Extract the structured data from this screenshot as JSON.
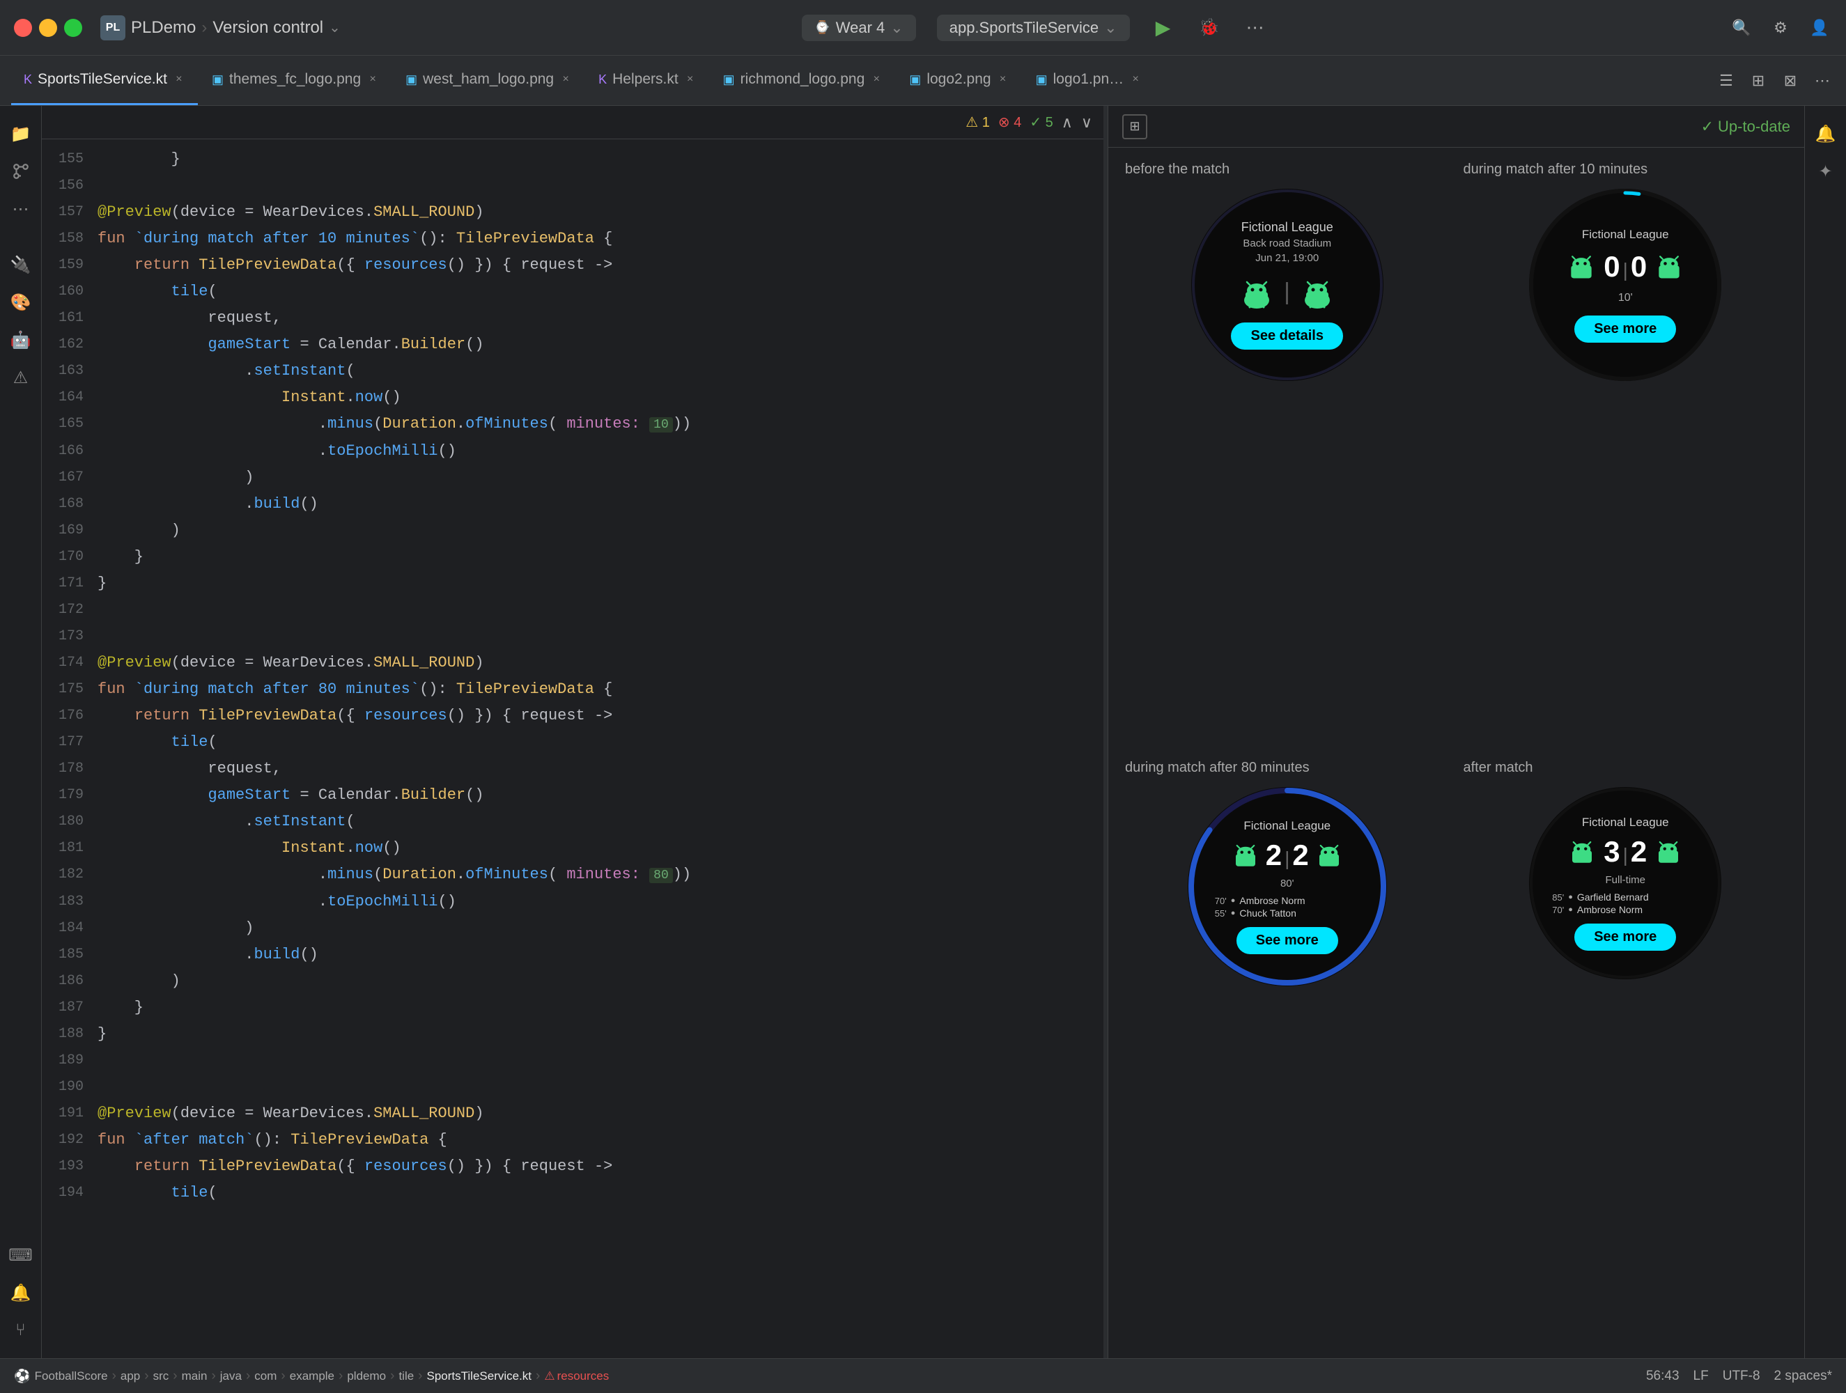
{
  "titlebar": {
    "traffic_lights": [
      "red",
      "yellow",
      "green"
    ],
    "brand_label": "PL",
    "app_name": "PLDemo",
    "vcs_label": "Version control",
    "device_label": "Wear 4",
    "service_label": "app.SportsTileService",
    "run_label": "▶",
    "debug_label": "🐞",
    "more_label": "⋯"
  },
  "tabs": [
    {
      "label": "SportsTileService.kt",
      "active": true,
      "icon": "kotlin"
    },
    {
      "label": "themes_fc_logo.png",
      "active": false,
      "icon": "image"
    },
    {
      "label": "west_ham_logo.png",
      "active": false,
      "icon": "image"
    },
    {
      "label": "Helpers.kt",
      "active": false,
      "icon": "kotlin"
    },
    {
      "label": "richmond_logo.png",
      "active": false,
      "icon": "image"
    },
    {
      "label": "logo2.png",
      "active": false,
      "icon": "image"
    },
    {
      "label": "logo1.pn…",
      "active": false,
      "icon": "image"
    }
  ],
  "editor": {
    "warnings": 1,
    "errors": 4,
    "hints": 5,
    "lines": [
      {
        "num": 155,
        "tokens": [
          {
            "t": "indent",
            "v": "\t\t}"
          },
          {
            "t": "ident",
            "v": ""
          }
        ]
      },
      {
        "num": 156,
        "tokens": []
      },
      {
        "num": 157,
        "tokens": [
          {
            "t": "ann",
            "v": "@Preview"
          },
          {
            "t": "ident",
            "v": "(device = WearDevices."
          },
          {
            "t": "type",
            "v": "SMALL_ROUND"
          },
          {
            "t": "ident",
            "v": ")"
          }
        ]
      },
      {
        "num": 158,
        "tokens": [
          {
            "t": "kw",
            "v": "fun "
          },
          {
            "t": "fn",
            "v": "`during match after 10 minutes`"
          },
          {
            "t": "ident",
            "v": "(): "
          },
          {
            "t": "type",
            "v": "TilePreviewData"
          },
          {
            "t": "ident",
            "v": " {"
          }
        ]
      },
      {
        "num": 159,
        "tokens": [
          {
            "t": "ident",
            "v": "\t\t\t"
          },
          {
            "t": "kw",
            "v": "return "
          },
          {
            "t": "type",
            "v": "TilePreviewData"
          },
          {
            "t": "ident",
            "v": "({ "
          },
          {
            "t": "fn",
            "v": "resources"
          },
          {
            "t": "ident",
            "v": "() }) { request ->"
          }
        ]
      },
      {
        "num": 160,
        "tokens": [
          {
            "t": "ident",
            "v": "\t\t\t\t"
          },
          {
            "t": "fn",
            "v": "tile"
          },
          {
            "t": "ident",
            "v": "("
          }
        ]
      },
      {
        "num": 161,
        "tokens": [
          {
            "t": "ident",
            "v": "\t\t\t\t\trequest,"
          }
        ]
      },
      {
        "num": 162,
        "tokens": [
          {
            "t": "ident",
            "v": "\t\t\t\t\t"
          },
          {
            "t": "fn",
            "v": "gameStart"
          },
          {
            "t": "ident",
            "v": " = Calendar."
          },
          {
            "t": "type",
            "v": "Builder"
          },
          {
            "t": "ident",
            "v": "()"
          }
        ]
      },
      {
        "num": 163,
        "tokens": [
          {
            "t": "ident",
            "v": "\t\t\t\t\t\t."
          },
          {
            "t": "fn",
            "v": "setInstant"
          },
          {
            "t": "ident",
            "v": "("
          }
        ]
      },
      {
        "num": 164,
        "tokens": [
          {
            "t": "ident",
            "v": "\t\t\t\t\t\t\t"
          },
          {
            "t": "type",
            "v": "Instant"
          },
          {
            "t": "ident",
            "v": "."
          },
          {
            "t": "fn",
            "v": "now"
          },
          {
            "t": "ident",
            "v": "()"
          }
        ]
      },
      {
        "num": 165,
        "tokens": [
          {
            "t": "ident",
            "v": "\t\t\t\t\t\t\t\t."
          },
          {
            "t": "fn",
            "v": "minus"
          },
          {
            "t": "ident",
            "v": "("
          },
          {
            "t": "type",
            "v": "Duration"
          },
          {
            "t": "ident",
            "v": "."
          },
          {
            "t": "fn",
            "v": "ofMinutes"
          },
          {
            "t": "ident",
            "v": "( "
          },
          {
            "t": "param",
            "v": "minutes:"
          },
          {
            "t": "ident",
            "v": " "
          },
          {
            "t": "hint",
            "v": "10"
          },
          {
            "t": "ident",
            "v": "))"
          }
        ]
      },
      {
        "num": 166,
        "tokens": [
          {
            "t": "ident",
            "v": "\t\t\t\t\t\t\t\t."
          },
          {
            "t": "fn",
            "v": "toEpochMilli"
          },
          {
            "t": "ident",
            "v": "()"
          }
        ]
      },
      {
        "num": 167,
        "tokens": [
          {
            "t": "ident",
            "v": "\t\t\t\t\t\t)"
          }
        ]
      },
      {
        "num": 168,
        "tokens": [
          {
            "t": "ident",
            "v": "\t\t\t\t\t\t."
          },
          {
            "t": "fn",
            "v": "build"
          },
          {
            "t": "ident",
            "v": "()"
          }
        ]
      },
      {
        "num": 169,
        "tokens": [
          {
            "t": "ident",
            "v": "\t\t\t\t)"
          }
        ]
      },
      {
        "num": 170,
        "tokens": [
          {
            "t": "ident",
            "v": "\t\t\t}"
          }
        ]
      },
      {
        "num": 171,
        "tokens": [
          {
            "t": "ident",
            "v": "\t\t}"
          }
        ]
      },
      {
        "num": 172,
        "tokens": []
      },
      {
        "num": 173,
        "tokens": []
      },
      {
        "num": 174,
        "tokens": [
          {
            "t": "ann",
            "v": "@Preview"
          },
          {
            "t": "ident",
            "v": "(device = WearDevices."
          },
          {
            "t": "type",
            "v": "SMALL_ROUND"
          },
          {
            "t": "ident",
            "v": ")"
          }
        ]
      },
      {
        "num": 175,
        "tokens": [
          {
            "t": "kw",
            "v": "fun "
          },
          {
            "t": "fn",
            "v": "`during match after 80 minutes`"
          },
          {
            "t": "ident",
            "v": "(): "
          },
          {
            "t": "type",
            "v": "TilePreviewData"
          },
          {
            "t": "ident",
            "v": " {"
          }
        ]
      },
      {
        "num": 176,
        "tokens": [
          {
            "t": "ident",
            "v": "\t\t\t"
          },
          {
            "t": "kw",
            "v": "return "
          },
          {
            "t": "type",
            "v": "TilePreviewData"
          },
          {
            "t": "ident",
            "v": "({ "
          },
          {
            "t": "fn",
            "v": "resources"
          },
          {
            "t": "ident",
            "v": "() }) { request ->"
          }
        ]
      },
      {
        "num": 177,
        "tokens": [
          {
            "t": "ident",
            "v": "\t\t\t\t"
          },
          {
            "t": "fn",
            "v": "tile"
          },
          {
            "t": "ident",
            "v": "("
          }
        ]
      },
      {
        "num": 178,
        "tokens": [
          {
            "t": "ident",
            "v": "\t\t\t\t\trequest,"
          }
        ]
      },
      {
        "num": 179,
        "tokens": [
          {
            "t": "ident",
            "v": "\t\t\t\t\t"
          },
          {
            "t": "fn",
            "v": "gameStart"
          },
          {
            "t": "ident",
            "v": " = Calendar."
          },
          {
            "t": "type",
            "v": "Builder"
          },
          {
            "t": "ident",
            "v": "()"
          }
        ]
      },
      {
        "num": 180,
        "tokens": [
          {
            "t": "ident",
            "v": "\t\t\t\t\t\t."
          },
          {
            "t": "fn",
            "v": "setInstant"
          },
          {
            "t": "ident",
            "v": "("
          }
        ]
      },
      {
        "num": 181,
        "tokens": [
          {
            "t": "ident",
            "v": "\t\t\t\t\t\t\t"
          },
          {
            "t": "type",
            "v": "Instant"
          },
          {
            "t": "ident",
            "v": "."
          },
          {
            "t": "fn",
            "v": "now"
          },
          {
            "t": "ident",
            "v": "()"
          }
        ]
      },
      {
        "num": 182,
        "tokens": [
          {
            "t": "ident",
            "v": "\t\t\t\t\t\t\t\t."
          },
          {
            "t": "fn",
            "v": "minus"
          },
          {
            "t": "ident",
            "v": "("
          },
          {
            "t": "type",
            "v": "Duration"
          },
          {
            "t": "ident",
            "v": "."
          },
          {
            "t": "fn",
            "v": "ofMinutes"
          },
          {
            "t": "ident",
            "v": "( "
          },
          {
            "t": "param",
            "v": "minutes:"
          },
          {
            "t": "ident",
            "v": " "
          },
          {
            "t": "hint",
            "v": "80"
          },
          {
            "t": "ident",
            "v": "))"
          }
        ]
      },
      {
        "num": 183,
        "tokens": [
          {
            "t": "ident",
            "v": "\t\t\t\t\t\t\t\t."
          },
          {
            "t": "fn",
            "v": "toEpochMilli"
          },
          {
            "t": "ident",
            "v": "()"
          }
        ]
      },
      {
        "num": 184,
        "tokens": [
          {
            "t": "ident",
            "v": "\t\t\t\t\t\t)"
          }
        ]
      },
      {
        "num": 185,
        "tokens": [
          {
            "t": "ident",
            "v": "\t\t\t\t\t\t."
          },
          {
            "t": "fn",
            "v": "build"
          },
          {
            "t": "ident",
            "v": "()"
          }
        ]
      },
      {
        "num": 186,
        "tokens": [
          {
            "t": "ident",
            "v": "\t\t\t\t)"
          }
        ]
      },
      {
        "num": 187,
        "tokens": [
          {
            "t": "ident",
            "v": "\t\t\t}"
          }
        ]
      },
      {
        "num": 188,
        "tokens": [
          {
            "t": "ident",
            "v": "\t\t}"
          }
        ]
      },
      {
        "num": 189,
        "tokens": []
      },
      {
        "num": 190,
        "tokens": []
      },
      {
        "num": 191,
        "tokens": [
          {
            "t": "ann",
            "v": "@Preview"
          },
          {
            "t": "ident",
            "v": "(device = WearDevices."
          },
          {
            "t": "type",
            "v": "SMALL_ROUND"
          },
          {
            "t": "ident",
            "v": ")"
          }
        ]
      },
      {
        "num": 192,
        "tokens": [
          {
            "t": "kw",
            "v": "fun "
          },
          {
            "t": "fn",
            "v": "`after match`"
          },
          {
            "t": "ident",
            "v": "(): "
          },
          {
            "t": "type",
            "v": "TilePreviewData"
          },
          {
            "t": "ident",
            "v": " {"
          }
        ]
      },
      {
        "num": 193,
        "tokens": [
          {
            "t": "ident",
            "v": "\t\t\t"
          },
          {
            "t": "kw",
            "v": "return "
          },
          {
            "t": "type",
            "v": "TilePreviewData"
          },
          {
            "t": "ident",
            "v": "({ "
          },
          {
            "t": "fn",
            "v": "resources"
          },
          {
            "t": "ident",
            "v": "() }) { request ->"
          }
        ]
      },
      {
        "num": 194,
        "tokens": [
          {
            "t": "ident",
            "v": "\t\t\t\t"
          },
          {
            "t": "fn",
            "v": "tile"
          },
          {
            "t": "ident",
            "v": "("
          }
        ]
      }
    ]
  },
  "preview": {
    "status": "Up-to-date",
    "cards": [
      {
        "label": "before the match",
        "type": "before",
        "league": "Fictional League",
        "venue": "Back road Stadium",
        "date": "Jun 21, 19:00",
        "button_label": "See details"
      },
      {
        "label": "during match after 10 minutes",
        "type": "during_10",
        "league": "Fictional League",
        "score_home": "0",
        "score_away": "0",
        "minute": "10'",
        "button_label": "See more"
      },
      {
        "label": "during match after 80 minutes",
        "type": "during_80",
        "league": "Fictional League",
        "score_home": "2",
        "score_away": "2",
        "minute": "80'",
        "scorers": [
          {
            "minute": "70'",
            "name": "Ambrose Norm"
          },
          {
            "minute": "55'",
            "name": "Chuck Tatton"
          }
        ],
        "button_label": "See more"
      },
      {
        "label": "after match",
        "type": "after",
        "league": "Fictional League",
        "score_home": "3",
        "score_away": "2",
        "status": "Full-time",
        "scorers": [
          {
            "minute": "85'",
            "name": "Garfield Bernard"
          },
          {
            "minute": "70'",
            "name": "Ambrose Norm"
          }
        ],
        "button_label": "See more"
      }
    ]
  },
  "statusbar": {
    "breadcrumb": "⚽ FootballScore › app › src › main › java › com › example › pldemo › tile › SportsTileService.kt",
    "warning_icon": "⚠",
    "resources_label": "resources",
    "position": "56:43",
    "encoding": "UTF-8",
    "line_ending": "LF",
    "indent": "2 spaces*"
  }
}
